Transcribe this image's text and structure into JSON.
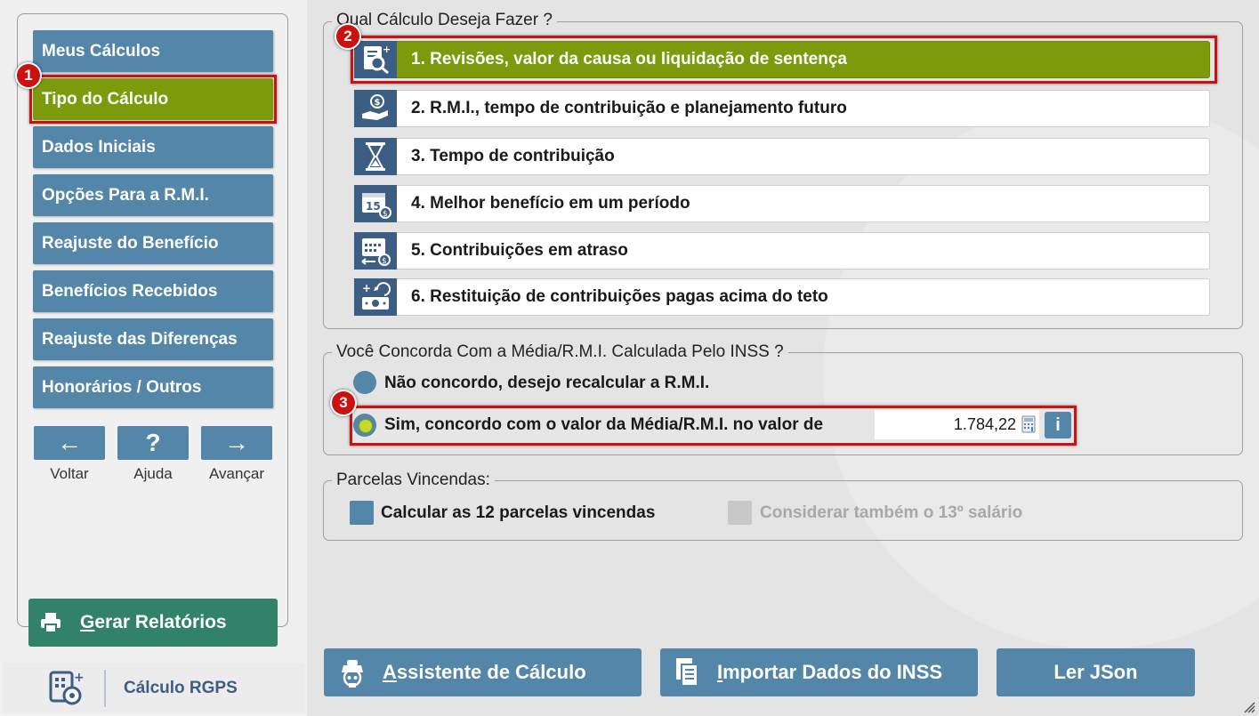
{
  "sidebar": {
    "items": [
      {
        "label": "Meus Cálculos"
      },
      {
        "label": "Tipo do Cálculo"
      },
      {
        "label": "Dados Iniciais"
      },
      {
        "label": "Opções Para a R.M.I."
      },
      {
        "label": "Reajuste do Benefício"
      },
      {
        "label": "Benefícios Recebidos"
      },
      {
        "label": "Reajuste das Diferenças"
      },
      {
        "label": "Honorários / Outros"
      }
    ],
    "active_index": 1,
    "nav": {
      "back_icon": "←",
      "back_label": "Voltar",
      "help_icon": "?",
      "help_label": "Ajuda",
      "next_icon": "→",
      "next_label": "Avançar"
    },
    "report_button": {
      "mnemonic": "G",
      "rest": "erar Relatórios"
    },
    "logo_text": "Cálculo RGPS"
  },
  "badges": {
    "one": "1",
    "two": "2",
    "three": "3"
  },
  "calc_group": {
    "title": "Qual Cálculo Deseja Fazer ?",
    "options": [
      {
        "label": "1. Revisões, valor da causa ou liquidação de sentença",
        "icon": "document-search-icon"
      },
      {
        "label": "2. R.M.I., tempo de contribuição e planejamento futuro",
        "icon": "hand-money-icon"
      },
      {
        "label": "3. Tempo de contribuição",
        "icon": "hourglass-icon"
      },
      {
        "label": "4. Melhor benefício em um período",
        "icon": "calendar-15-icon"
      },
      {
        "label": "5. Contribuições em atraso",
        "icon": "calendar-money-icon"
      },
      {
        "label": "6. Restituição de contribuições pagas acima do teto",
        "icon": "cash-return-icon"
      }
    ],
    "selected_index": 0
  },
  "rmi_group": {
    "title": "Você Concorda Com a Média/R.M.I. Calculada Pelo INSS ?",
    "option_disagree": "Não concordo, desejo recalcular a R.M.I.",
    "option_agree": "Sim, concordo com o valor da Média/R.M.I. no valor de",
    "value": "1.784,22",
    "info_label": "i",
    "selected": "agree"
  },
  "parcelas_group": {
    "title": "Parcelas Vincendas:",
    "calc12_label": "Calcular as 12 parcelas vincendas",
    "consider13_label": "Considerar também o 13º salário"
  },
  "bottom": {
    "assistant": {
      "mnemonic": "A",
      "rest": "ssistente de Cálculo"
    },
    "import": {
      "mnemonic": "I",
      "rest": "mportar Dados do INSS"
    },
    "json": "Ler JSon"
  },
  "colors": {
    "primary": "#5386a8",
    "selected": "#7d9a0c",
    "report": "#32826a",
    "highlight": "#cc1111",
    "icon_bg": "#3c5d84"
  }
}
